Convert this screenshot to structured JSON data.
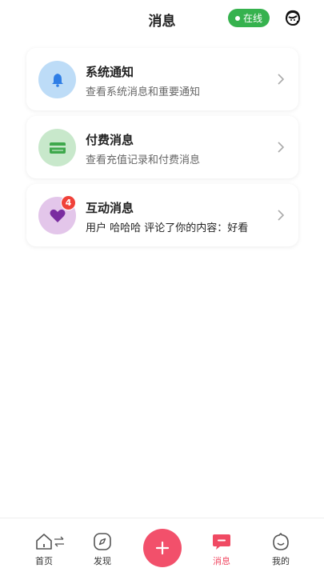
{
  "header": {
    "title": "消息",
    "status_label": "在线"
  },
  "messages": [
    {
      "name": "系统通知",
      "desc": "查看系统消息和重要通知",
      "icon": "bell-icon",
      "color": "#2f7ee6",
      "bg": "#bddcf7"
    },
    {
      "name": "付费消息",
      "desc": "查看充值记录和付费消息",
      "icon": "card-icon",
      "color": "#3fa84c",
      "bg": "#c8e8cb"
    },
    {
      "name": "互动消息",
      "desc": "用户 哈哈哈 评论了你的内容：好看",
      "icon": "heart-icon",
      "color": "#7a2ca0",
      "bg": "#e3c6ea",
      "badge": "4"
    }
  ],
  "tabbar": {
    "home": "首页",
    "discover": "发现",
    "messages": "消息",
    "mine": "我的"
  },
  "colors": {
    "accent": "#f04a63",
    "online": "#36b24e",
    "badge": "#f0413a"
  }
}
